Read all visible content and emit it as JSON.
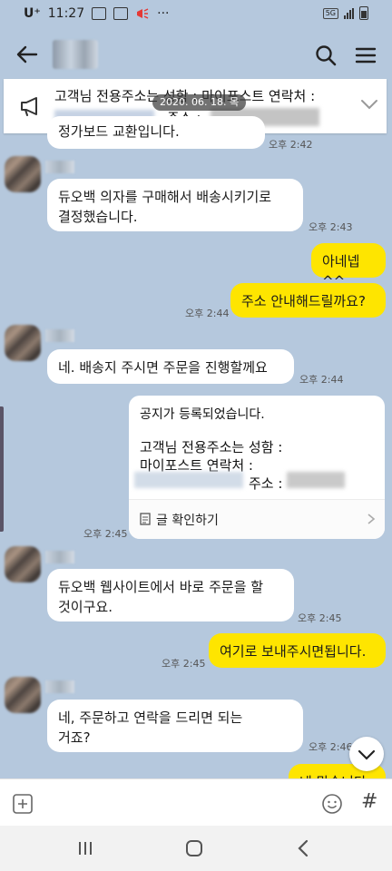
{
  "status_bar": {
    "carrier": "U⁺",
    "time": "11:27",
    "menu_dots": "···",
    "network": "5G"
  },
  "header": {
    "back_icon": "arrow-left-icon",
    "search_icon": "search-icon",
    "menu_icon": "hamburger-icon"
  },
  "notice": {
    "line1": "고객님 전용주소는   성함 : 마이포스트 연락처 :",
    "line2": "주소 :",
    "date_overlay": "2020. 06. 18. 목",
    "icon": "megaphone-icon"
  },
  "messages": {
    "m0": {
      "text": "정가보드 교환입니다.",
      "time": "오후 2:42"
    },
    "m1": {
      "text1": "듀오백 의자를 구매해서 배송시키기로",
      "text2": "결정했습니다.",
      "time": "오후 2:43"
    },
    "m2": {
      "text": "아네넵^^"
    },
    "m3": {
      "text": "주소 안내해드릴까요?",
      "time": "오후 2:44"
    },
    "m4": {
      "text": "네. 배송지 주시면 주문을 진행할께요",
      "time": "오후 2:44"
    },
    "m5": {
      "title": "공지가 등록되었습니다.",
      "line1": "고객님 전용주소는   성함 :",
      "line2": "마이포스트 연락처 :",
      "line3": "주소 :",
      "footer": "글 확인하기",
      "time": "오후 2:45"
    },
    "m6": {
      "text1": "듀오백 웹사이트에서 바로 주문을 할",
      "text2": "것이구요.",
      "time": "오후 2:45"
    },
    "m7": {
      "text": "여기로 보내주시면됩니다.",
      "time": "오후 2:45"
    },
    "m8": {
      "text1": "네, 주문하고 연락을 드리면 되는",
      "text2": "거죠?",
      "time": "오후 2:46"
    },
    "m9": {
      "text": "네 맞습니다"
    }
  },
  "input": {
    "placeholder": "",
    "hash": "#"
  },
  "colors": {
    "background": "#b5c8dd",
    "outgoing_bubble": "#fee500",
    "incoming_bubble": "#ffffff"
  }
}
